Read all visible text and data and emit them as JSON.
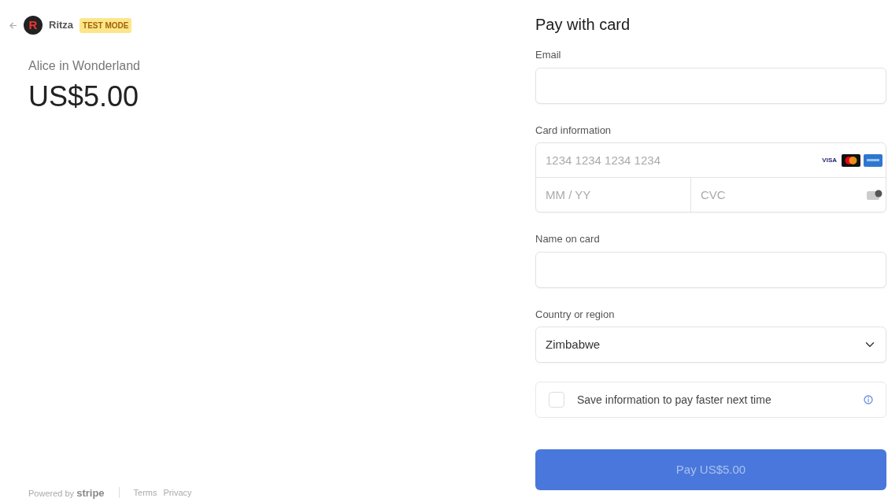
{
  "header": {
    "merchant": "Ritza",
    "logo_letter": "R",
    "mode_badge": "TEST MODE"
  },
  "product": {
    "name": "Alice in Wonderland",
    "price": "US$5.00"
  },
  "footer": {
    "powered_by": "Powered by",
    "brand": "stripe",
    "links": [
      "Terms",
      "Privacy"
    ]
  },
  "form": {
    "title": "Pay with card",
    "email": {
      "label": "Email"
    },
    "card": {
      "label": "Card information",
      "number_placeholder": "1234 1234 1234 1234",
      "expiry_placeholder": "MM / YY",
      "cvc_placeholder": "CVC",
      "brands": [
        "VISA"
      ]
    },
    "name": {
      "label": "Name on card"
    },
    "country": {
      "label": "Country or region",
      "value": "Zimbabwe"
    },
    "save": {
      "label": "Save information to pay faster next time",
      "checked": false
    },
    "pay_button": {
      "label": "Pay US$5.00",
      "disabled": true
    }
  }
}
